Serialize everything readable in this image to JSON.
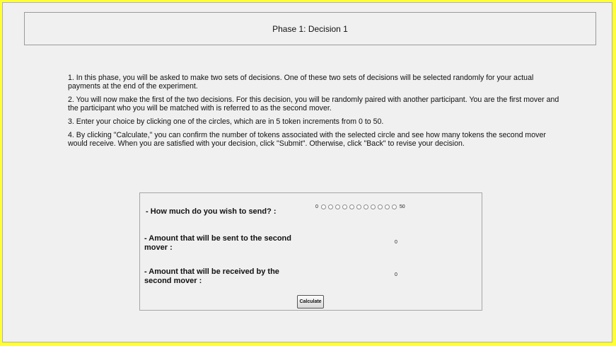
{
  "header": {
    "title": "Phase 1: Decision 1"
  },
  "instructions": [
    " 1. In this phase, you will be asked to make two sets of decisions. One of these two sets of decisions will be selected randomly for your actual payments at the end of the experiment.",
    " 2. You will now make the first of the two decisions. For this decision, you will be randomly paired with another participant. You are the first mover and the participant who you will be matched with is referred to as the second mover.",
    "3. Enter your choice by clicking one of the circles, which are in 5 token increments from 0 to 50.",
    "4. By clicking \"Calculate,\" you can confirm the number of tokens associated with the selected circle and see how many tokens the second mover would receive. When you are satisfied with your decision, click \"Submit\". Otherwise, click \"Back\" to revise your decision."
  ],
  "decision": {
    "send_question": "- How much do you wish to send? :",
    "scale_min_label": "0",
    "scale_max_label": "50",
    "radio_count": 11,
    "sent_label": "- Amount that will be sent to the second mover :",
    "sent_value": "0",
    "received_label": "- Amount that will be received by the second mover :",
    "received_value": "0",
    "calculate_label": "Calculate"
  }
}
